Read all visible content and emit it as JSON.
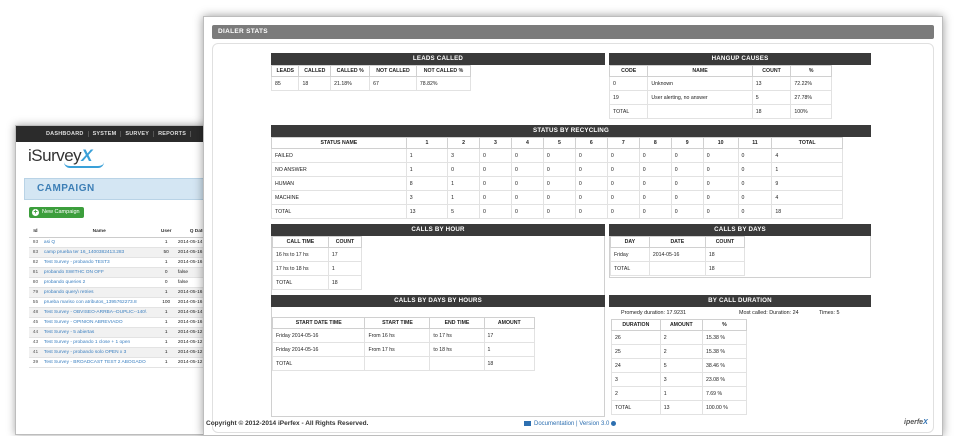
{
  "back": {
    "nav": [
      "DASHBOARD",
      "SYSTEM",
      "SURVEY",
      "REPORTS"
    ],
    "logo": {
      "text": "iSurvey",
      "mark": "X"
    },
    "campaign_title": "CAMPAIGN",
    "new_campaign_label": "New Campaign",
    "table": {
      "headers": [
        "Id",
        "Name",
        "User",
        "Q Date"
      ],
      "rows": [
        [
          "93",
          "asi Q",
          "1",
          "2014-05-14"
        ],
        [
          "83",
          "camp prueba ter 16_1400382413.283",
          "50",
          "2014-05-16"
        ],
        [
          "82",
          "Test Survey - probando TEST3",
          "1",
          "2014-05-16"
        ],
        [
          "81",
          "probando SWITHC ON OFF",
          "0",
          "false"
        ],
        [
          "80",
          "probando queries 2",
          "0",
          "false"
        ],
        [
          "79",
          "probando query\\ retries",
          "1",
          "2014-05-16"
        ],
        [
          "55",
          "prueba mariso con atributos_1395762273.8",
          "100",
          "2014-05-16"
        ],
        [
          "48",
          "Test Survey - OBVISEO-ARRBA--DUPLIC--140\\",
          "1",
          "2014-05-14"
        ],
        [
          "45",
          "Test Survey - OPINION ABREVIADO",
          "1",
          "2014-05-16"
        ],
        [
          "44",
          "Test Survey - 5 abiertas",
          "1",
          "2014-05-12"
        ],
        [
          "43",
          "Test Survey - probando 1 close + 1 open",
          "1",
          "2014-05-12"
        ],
        [
          "41",
          "Test Survey - probando solo OPEN x 3",
          "1",
          "2014-05-12"
        ],
        [
          "39",
          "Test Survey - BROADCAST TEST 2 ABOGADO",
          "1",
          "2014-05-12"
        ]
      ]
    }
  },
  "front": {
    "header": "DIALER STATS",
    "leads_called": {
      "title": "LEADS CALLED",
      "headers": [
        "LEADS",
        "CALLED",
        "CALLED %",
        "NOT CALLED",
        "NOT CALLED %"
      ],
      "row": [
        "85",
        "18",
        "21.18%",
        "67",
        "78.82%"
      ]
    },
    "hangup": {
      "title": "HANGUP CAUSES",
      "headers": [
        "CODE",
        "NAME",
        "COUNT",
        "%"
      ],
      "rows": [
        [
          "0",
          "Unknown",
          "13",
          "72.22%"
        ],
        [
          "19",
          "User alerting, no answer",
          "5",
          "27.78%"
        ],
        [
          "TOTAL",
          "",
          "18",
          "100%"
        ]
      ]
    },
    "recycling": {
      "title": "STATUS BY RECYCLING",
      "headers": [
        "STATUS NAME",
        "1",
        "2",
        "3",
        "4",
        "5",
        "6",
        "7",
        "8",
        "9",
        "10",
        "11",
        "TOTAL"
      ],
      "rows": [
        [
          "FAILED",
          "1",
          "3",
          "0",
          "0",
          "0",
          "0",
          "0",
          "0",
          "0",
          "0",
          "0",
          "4"
        ],
        [
          "NO ANSWER",
          "1",
          "0",
          "0",
          "0",
          "0",
          "0",
          "0",
          "0",
          "0",
          "0",
          "0",
          "1"
        ],
        [
          "HUMAN",
          "8",
          "1",
          "0",
          "0",
          "0",
          "0",
          "0",
          "0",
          "0",
          "0",
          "0",
          "9"
        ],
        [
          "MACHINE",
          "3",
          "1",
          "0",
          "0",
          "0",
          "0",
          "0",
          "0",
          "0",
          "0",
          "0",
          "4"
        ],
        [
          "TOTAL",
          "13",
          "5",
          "0",
          "0",
          "0",
          "0",
          "0",
          "0",
          "0",
          "0",
          "0",
          "18"
        ]
      ]
    },
    "by_hour": {
      "title": "CALLS BY HOUR",
      "headers": [
        "CALL TIME",
        "COUNT"
      ],
      "rows": [
        [
          "16 hs to 17 hs",
          "17"
        ],
        [
          "17 hs to 18 hs",
          "1"
        ],
        [
          "TOTAL",
          "18"
        ]
      ]
    },
    "by_days": {
      "title": "CALLS BY DAYS",
      "headers": [
        "DAY",
        "DATE",
        "COUNT"
      ],
      "rows": [
        [
          "Friday",
          "2014-05-16",
          "18"
        ],
        [
          "TOTAL",
          "",
          "18"
        ]
      ]
    },
    "by_days_hours": {
      "title": "CALLS BY DAYS BY HOURS",
      "headers": [
        "START DATE TIME",
        "START TIME",
        "END TIME",
        "AMOUNT"
      ],
      "rows": [
        [
          "Friday 2014-05-16",
          "From 16 hs",
          "to 17 hs",
          "17"
        ],
        [
          "Friday 2014-05-16",
          "From 17 hs",
          "to 18 hs",
          "1"
        ],
        [
          "TOTAL",
          "",
          "",
          "18"
        ]
      ]
    },
    "by_duration": {
      "title": "BY CALL DURATION",
      "summary": {
        "promedy": "Promedy duration: 17.9231",
        "most": "Most called:  Duration: 24",
        "times": "Times: 5"
      },
      "headers": [
        "DURATION",
        "AMOUNT",
        "%"
      ],
      "rows": [
        [
          "26",
          "2",
          "15.38 %"
        ],
        [
          "25",
          "2",
          "15.38 %"
        ],
        [
          "24",
          "5",
          "38.46 %"
        ],
        [
          "3",
          "3",
          "23.08 %"
        ],
        [
          "2",
          "1",
          "7.69 %"
        ],
        [
          "TOTAL",
          "13",
          "100.00 %"
        ]
      ]
    }
  },
  "footer": {
    "copyright": "Copyright © 2012-2014 iPerfex - All Rights Reserved.",
    "documentation": "Documentation",
    "separator": "|",
    "version": "Version 3.0",
    "brand": "iperfe",
    "brand_mark": "X"
  }
}
